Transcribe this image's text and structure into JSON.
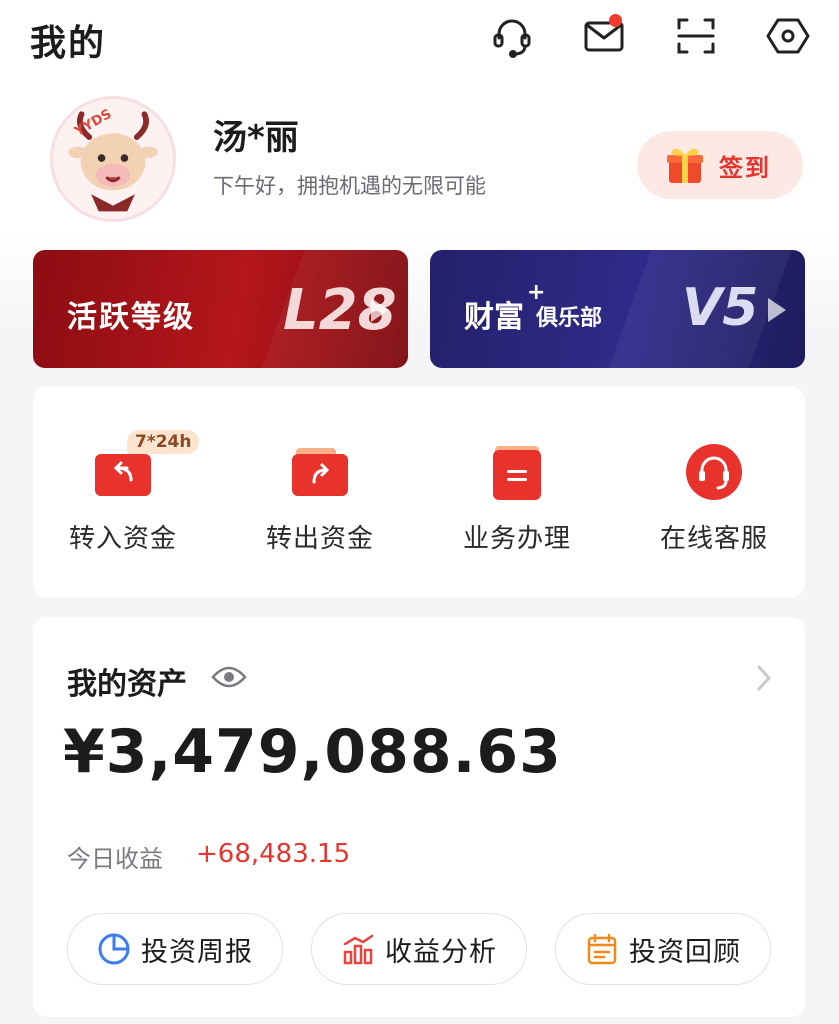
{
  "header": {
    "title": "我的",
    "icons": [
      "headset-icon",
      "mail-icon",
      "scan-icon",
      "settings-icon"
    ],
    "has_unread_mail": true
  },
  "profile": {
    "avatar_text": "YYDS",
    "name": "汤*丽",
    "greeting": "下午好，拥抱机遇的无限可能",
    "checkin_label": "签到"
  },
  "level_cards": {
    "active": {
      "label": "活跃等级",
      "value": "L28"
    },
    "wealth": {
      "label": "财富",
      "plus": "+",
      "sub": "俱乐部",
      "value": "V5"
    }
  },
  "quick_actions": [
    {
      "label": "转入资金",
      "badge": "7*24h",
      "icon": "transfer-in-icon"
    },
    {
      "label": "转出资金",
      "icon": "transfer-out-icon"
    },
    {
      "label": "业务办理",
      "icon": "business-icon"
    },
    {
      "label": "在线客服",
      "icon": "customer-service-icon"
    }
  ],
  "assets": {
    "title": "我的资产",
    "amount": "¥3,479,088.63",
    "today_label": "今日收益",
    "today_value": "+68,483.15",
    "buttons": [
      {
        "label": "投资周报",
        "icon": "pie-chart-icon"
      },
      {
        "label": "收益分析",
        "icon": "bar-chart-icon"
      },
      {
        "label": "投资回顾",
        "icon": "calendar-icon"
      }
    ]
  },
  "colors": {
    "accent_red": "#e3362f",
    "level_red": "#a0141a",
    "wealth_blue": "#2a2680",
    "background": "#f5f5f7"
  }
}
